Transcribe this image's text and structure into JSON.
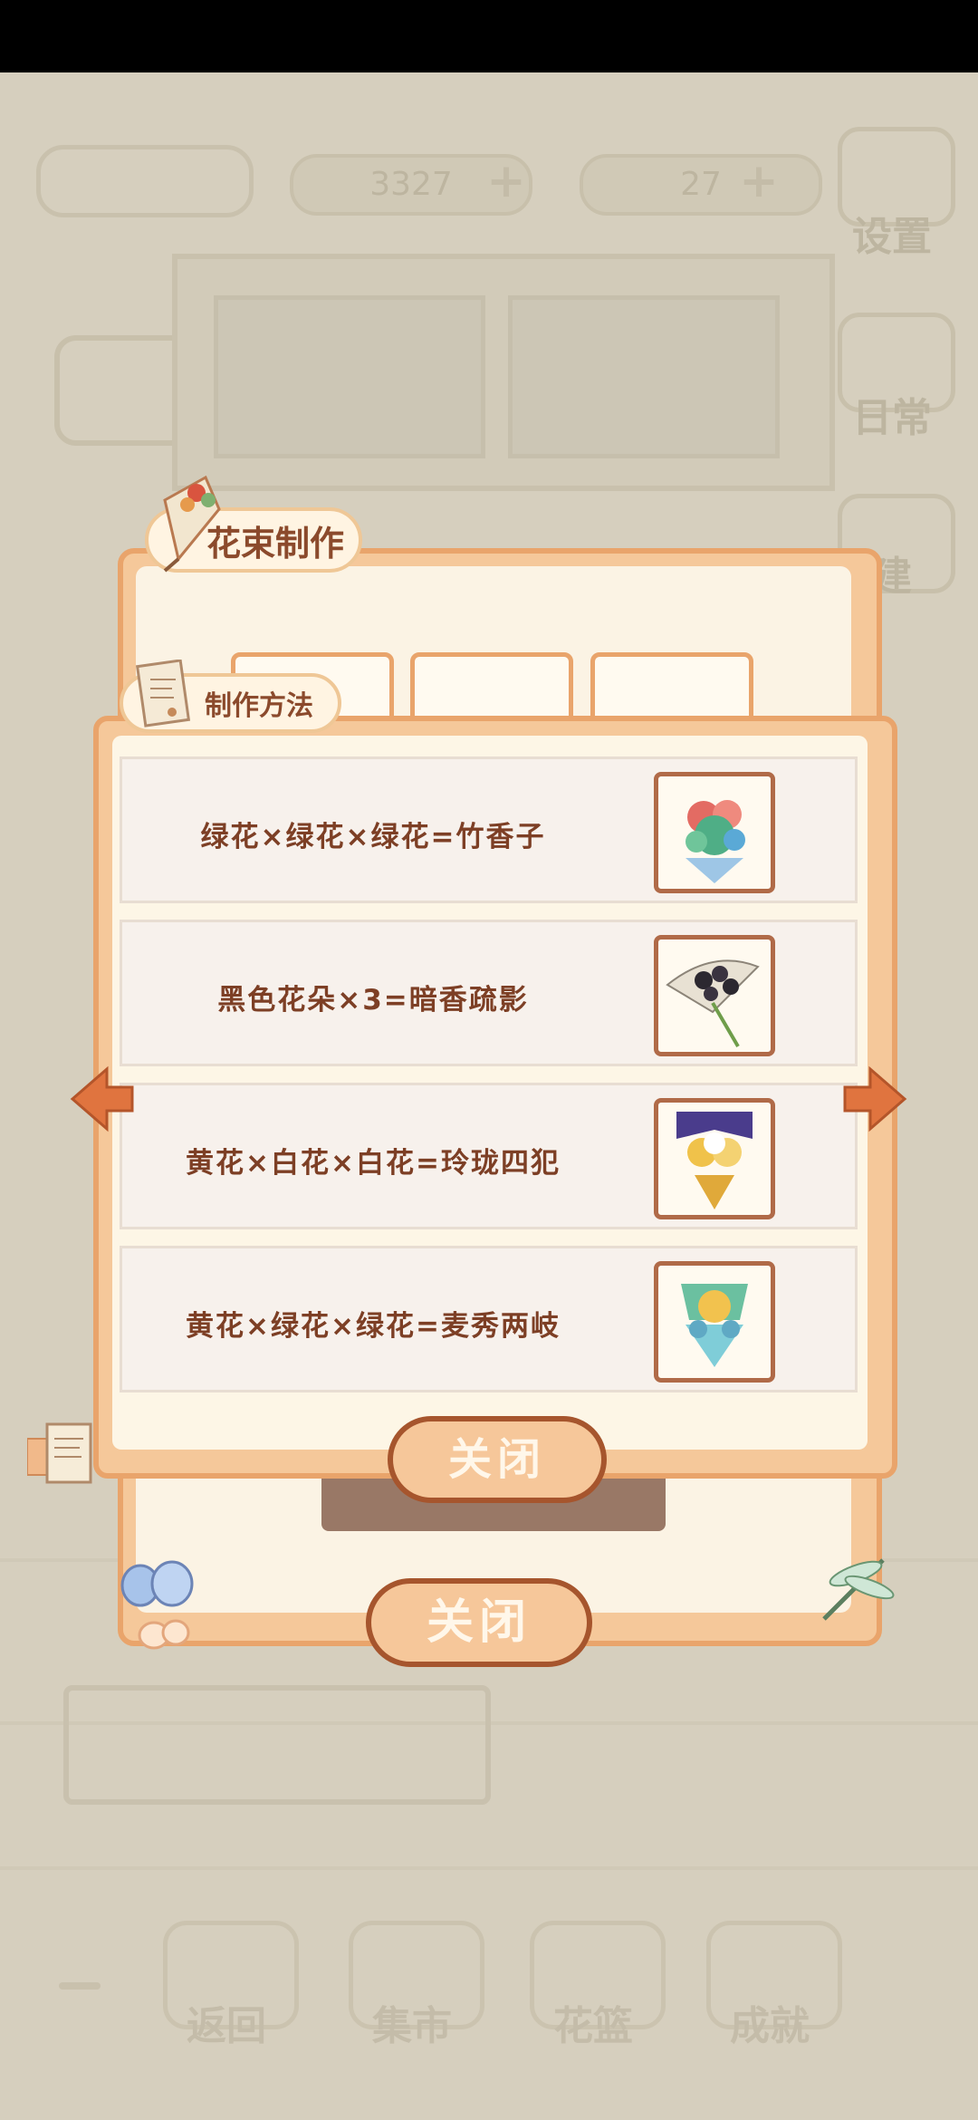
{
  "background": {
    "fish_count": "3327",
    "cheese_count": "27",
    "settings_label": "设置",
    "daily_label": "日常",
    "build_label": "建",
    "bottom_nav": [
      "返回",
      "集市",
      "花篮",
      "成就"
    ]
  },
  "bouquet_panel": {
    "title": "花束制作",
    "close_label": "关闭"
  },
  "recipe_panel": {
    "title": "制作方法",
    "close_label": "关闭",
    "recipes": [
      {
        "text": "绿花×绿花×绿花=竹香子",
        "icon": "bouquet-green-icon"
      },
      {
        "text": "黑色花朵×3=暗香疏影",
        "icon": "bouquet-black-icon"
      },
      {
        "text": "黄花×白花×白花=玲珑四犯",
        "icon": "bouquet-yellow-icon"
      },
      {
        "text": "黄花×绿花×绿花=麦秀两岐",
        "icon": "bouquet-teal-icon"
      }
    ]
  },
  "colors": {
    "panel_fill": "#f5c89a",
    "panel_border": "#e9a46b",
    "text_brown": "#7d3f25",
    "button_border": "#a6552d"
  }
}
